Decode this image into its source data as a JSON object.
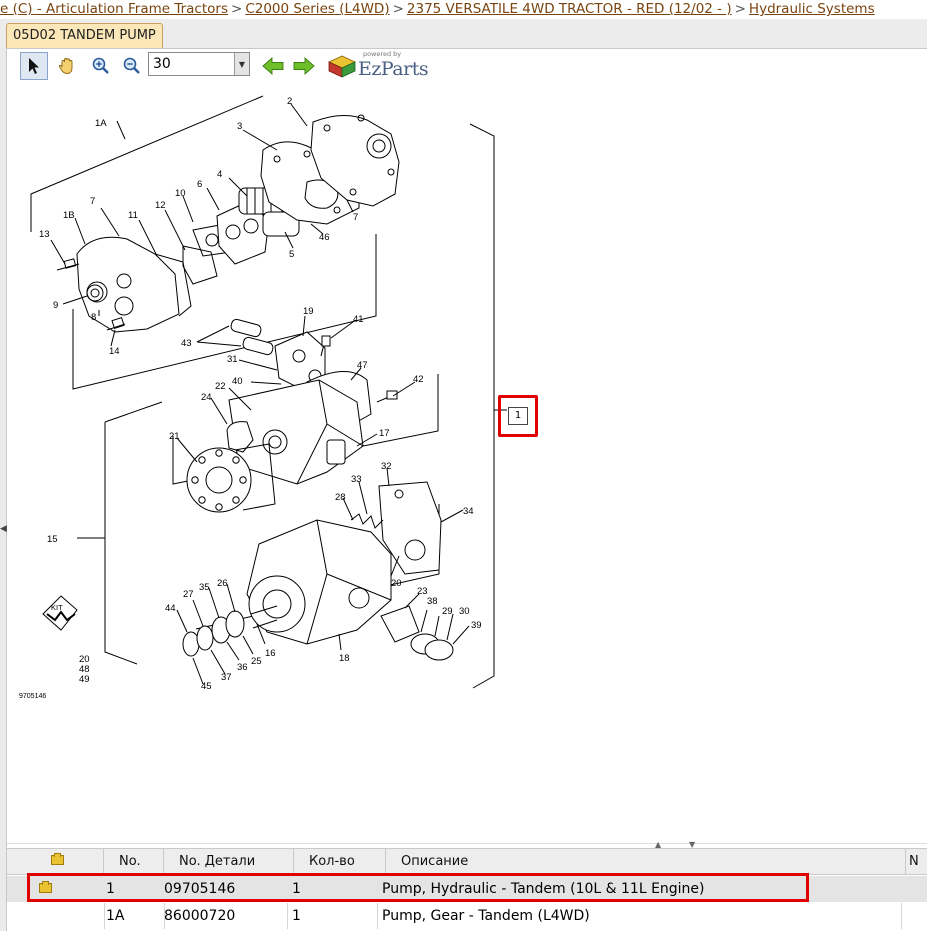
{
  "breadcrumb": {
    "items": [
      "e (C) - Articulation Frame Tractors",
      "C2000 Series (L4WD)",
      "2375 VERSATILE 4WD TRACTOR - RED (12/02 - )",
      "Hydraulic Systems"
    ],
    "separator": ">"
  },
  "tab": {
    "label": "05D02 TANDEM PUMP"
  },
  "toolbar": {
    "zoom_value": "30",
    "powered_by": "powered by",
    "brand": "EzParts",
    "icons": [
      "arrow-pointer-icon",
      "hand-pan-icon",
      "zoom-in-icon",
      "zoom-out-icon",
      "arrow-left-icon",
      "arrow-right-icon"
    ]
  },
  "diagram": {
    "drawing_number": "9705146",
    "callout_label": "1",
    "kit_label": "KIT",
    "labels": [
      "1A",
      "2",
      "3",
      "4",
      "5",
      "6",
      "7",
      "7",
      "10",
      "1B",
      "11",
      "12",
      "13",
      "9",
      "8",
      "14",
      "46",
      "19",
      "41",
      "43",
      "31",
      "47",
      "40",
      "42",
      "22",
      "24",
      "17",
      "21",
      "32",
      "33",
      "28",
      "34",
      "15",
      "20",
      "27",
      "35",
      "26",
      "44",
      "16",
      "25",
      "36",
      "37",
      "45",
      "23",
      "38",
      "29",
      "30",
      "39",
      "18",
      "20",
      "48",
      "49"
    ]
  },
  "grid": {
    "columns": [
      "No.",
      "No. Детали",
      "Кол-во",
      "Описание"
    ],
    "rows": [
      {
        "no": "1",
        "part": "09705146",
        "qty": "1",
        "desc": "Pump, Hydraulic - Tandem (10L & 11L Engine)",
        "selected": true
      },
      {
        "no": "1A",
        "part": "86000720",
        "qty": "1",
        "desc": "Pump, Gear - Tandem (L4WD)",
        "selected": false
      }
    ],
    "right_header_stub": "N"
  },
  "colors": {
    "highlight": "#e00000",
    "link": "#7a4410",
    "tab_bg": "#fbe7b8",
    "selected_row": "#e4e4e4",
    "folder": "#e9c331",
    "nav_arrow": "#6fbf2a"
  }
}
